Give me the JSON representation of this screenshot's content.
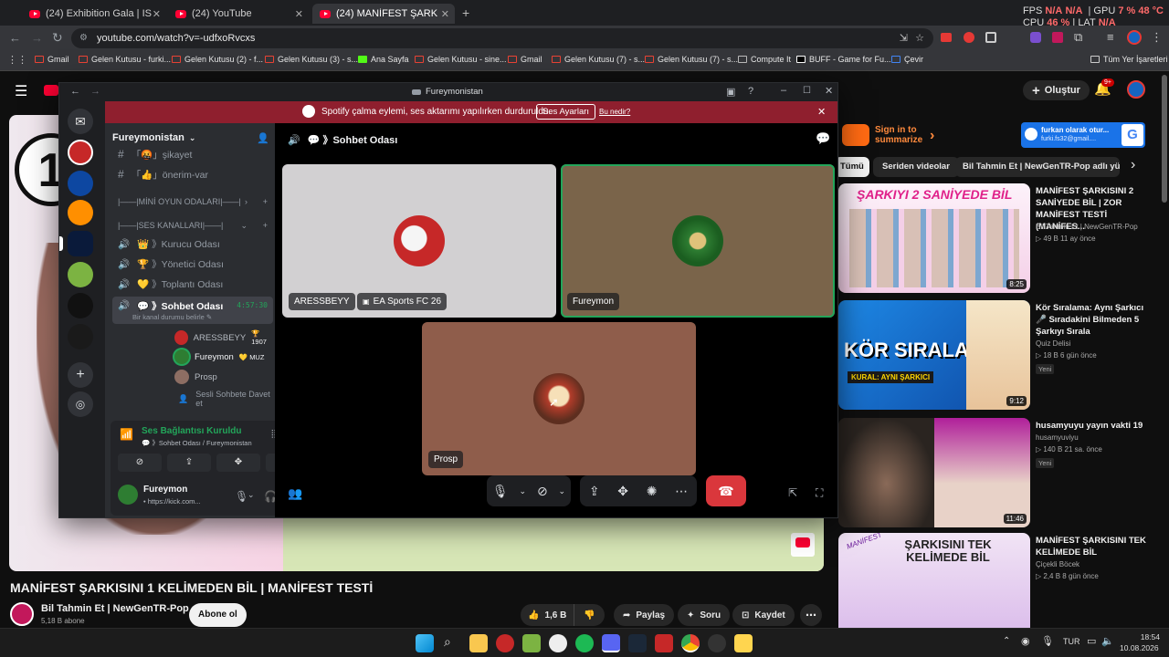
{
  "browser": {
    "tabs": [
      {
        "title": "(24) Exhibition Gala | ISU Figure",
        "close": "✕"
      },
      {
        "title": "(24) YouTube",
        "close": "✕"
      },
      {
        "title": "(24) MANİFEST ŞARKISINI 1 KE",
        "close": "✕"
      }
    ],
    "new_tab": "+",
    "url": "youtube.com/watch?v=-udfxoRvcxs",
    "perf": {
      "fps_label": "FPS",
      "fps_val": "N/A",
      "fps_val2": "N/A",
      "gpu_label": "GPU",
      "gpu_pct": "7 %",
      "gpu_temp": "48 °C",
      "cpu_label": "CPU",
      "cpu_pct": "46 %",
      "lat_label": "LAT",
      "lat_val": "N/A"
    },
    "bookmarks": [
      "Gmail",
      "Gelen Kutusu - furki...",
      "Gelen Kutusu (2) - f...",
      "Gelen Kutusu (3) - s...",
      "Ana Sayfa",
      "Gelen Kutusu - sine...",
      "Gmail",
      "Gelen Kutusu (7) - s...",
      "Gelen Kutusu (7) - s...",
      "Compute It",
      "BUFF - Game for Fu...",
      "Çevir"
    ],
    "all_bookmarks": "Tüm Yer İşaretleri"
  },
  "youtube": {
    "create": "Oluştur",
    "notif_count": "9+",
    "signin_text": "Sign in to summarize",
    "account_name": "furkan olarak otur...",
    "account_email": "furki.fs32@gmail....",
    "chips": [
      "Tümü",
      "Seriden videolar",
      "Bil Tahmin Et | NewGenTR-Pop adlı yükle"
    ],
    "video_title": "MANİFEST ŞARKISINI 1 KELİMEDEN BİL | MANİFEST TESTİ",
    "channel": "Bil Tahmin Et | NewGenTR-Pop",
    "subs": "5,18 B abone",
    "subscribe": "Abone ol",
    "likes": "1,6 B",
    "share": "Paylaş",
    "ask": "Soru",
    "save": "Kaydet",
    "player_logo": "1",
    "recs": [
      {
        "title": "MANİFEST ŞARKISINI 2 SANİYEDE BİL | ZOR MANİFEST TESTİ (MANİFES...",
        "channel": "Bil Tahmin Et | NewGenTR-Pop",
        "meta": "▷ 49 B  11 ay önce",
        "duration": "8:25",
        "thumb_text": "ŞARKIYI 2 SANİYEDE BİL",
        "badge": ""
      },
      {
        "title": "Kör Sıralama: Aynı Şarkıcı 🎤 Sıradakini Bilmeden 5 Şarkıyı Sırala",
        "channel": "Quiz Delisi",
        "meta": "▷ 18 B  6 gün önce",
        "duration": "9:12",
        "thumb_text": "KÖR SIRALAMA",
        "thumb_sub": "KURAL: AYNI ŞARKICI",
        "badge": "Yeni"
      },
      {
        "title": "husamyuyu yayın vakti 19",
        "channel": "husamyuviyu",
        "meta": "▷ 140 B  21 sa. önce",
        "duration": "11:46",
        "thumb_text": "",
        "badge": "Yeni"
      },
      {
        "title": "MANİFEST ŞARKISINI TEK KELİMEDE BİL",
        "channel": "Çiçekli Böcek",
        "meta": "▷ 2,4 B  8 gün önce",
        "duration": "",
        "thumb_text": "ŞARKISINI TEK KELİMEDE BİL",
        "thumb_sub": "MANİFEST",
        "badge": ""
      }
    ]
  },
  "discord": {
    "window_title": "Fureymonistan",
    "banner_text": "Spotify çalma eylemi, ses aktarımı yapılırken durduruldu.",
    "banner_button": "Ses Ayarları",
    "banner_link": "Bu nedir?",
    "server_name": "Fureymonistan",
    "voice_channel_header": "💬 》Sohbet Odası",
    "channels": [
      {
        "icon": "#",
        "name": "「🤬」şikayet"
      },
      {
        "icon": "#",
        "name": "「👍」önerim-var"
      }
    ],
    "categories": [
      "|——|MİNİ OYUN ODALARI|——|",
      "|——|SES KANALLARI|——|"
    ],
    "voice_channels": [
      {
        "icon": "🔊",
        "name": "👑 》Kurucu Odası"
      },
      {
        "icon": "🔊",
        "name": "🏆 》Yönetici Odası"
      },
      {
        "icon": "🔊",
        "name": "💛 》Toplantı Odası"
      }
    ],
    "active_channel": {
      "name": "💬 》Sohbet Odası",
      "timer": "4:57:30",
      "status": "Bir kanal durumu belirle ✎"
    },
    "members": [
      {
        "name": "ARESSBEYY",
        "tag": "🏆 1907"
      },
      {
        "name": "Fureymon",
        "tag": "💛 MUZ"
      },
      {
        "name": "Prosp",
        "tag": ""
      }
    ],
    "invite": "Sesli Sohbete Davet et",
    "voice_status": "Ses Bağlantısı Kuruldu",
    "voice_location": "💬 》Sohbet Odası / Fureymonistan",
    "user_name": "Fureymon",
    "user_status": "• https://kick.com...",
    "tiles": [
      {
        "name": "ARESSBEYY",
        "activity": "EA Sports FC 26"
      },
      {
        "name": "Fureymon"
      },
      {
        "name": "Prosp"
      }
    ]
  },
  "taskbar": {
    "lang": "TUR",
    "time": "18:54",
    "date": "10.08.2026"
  }
}
